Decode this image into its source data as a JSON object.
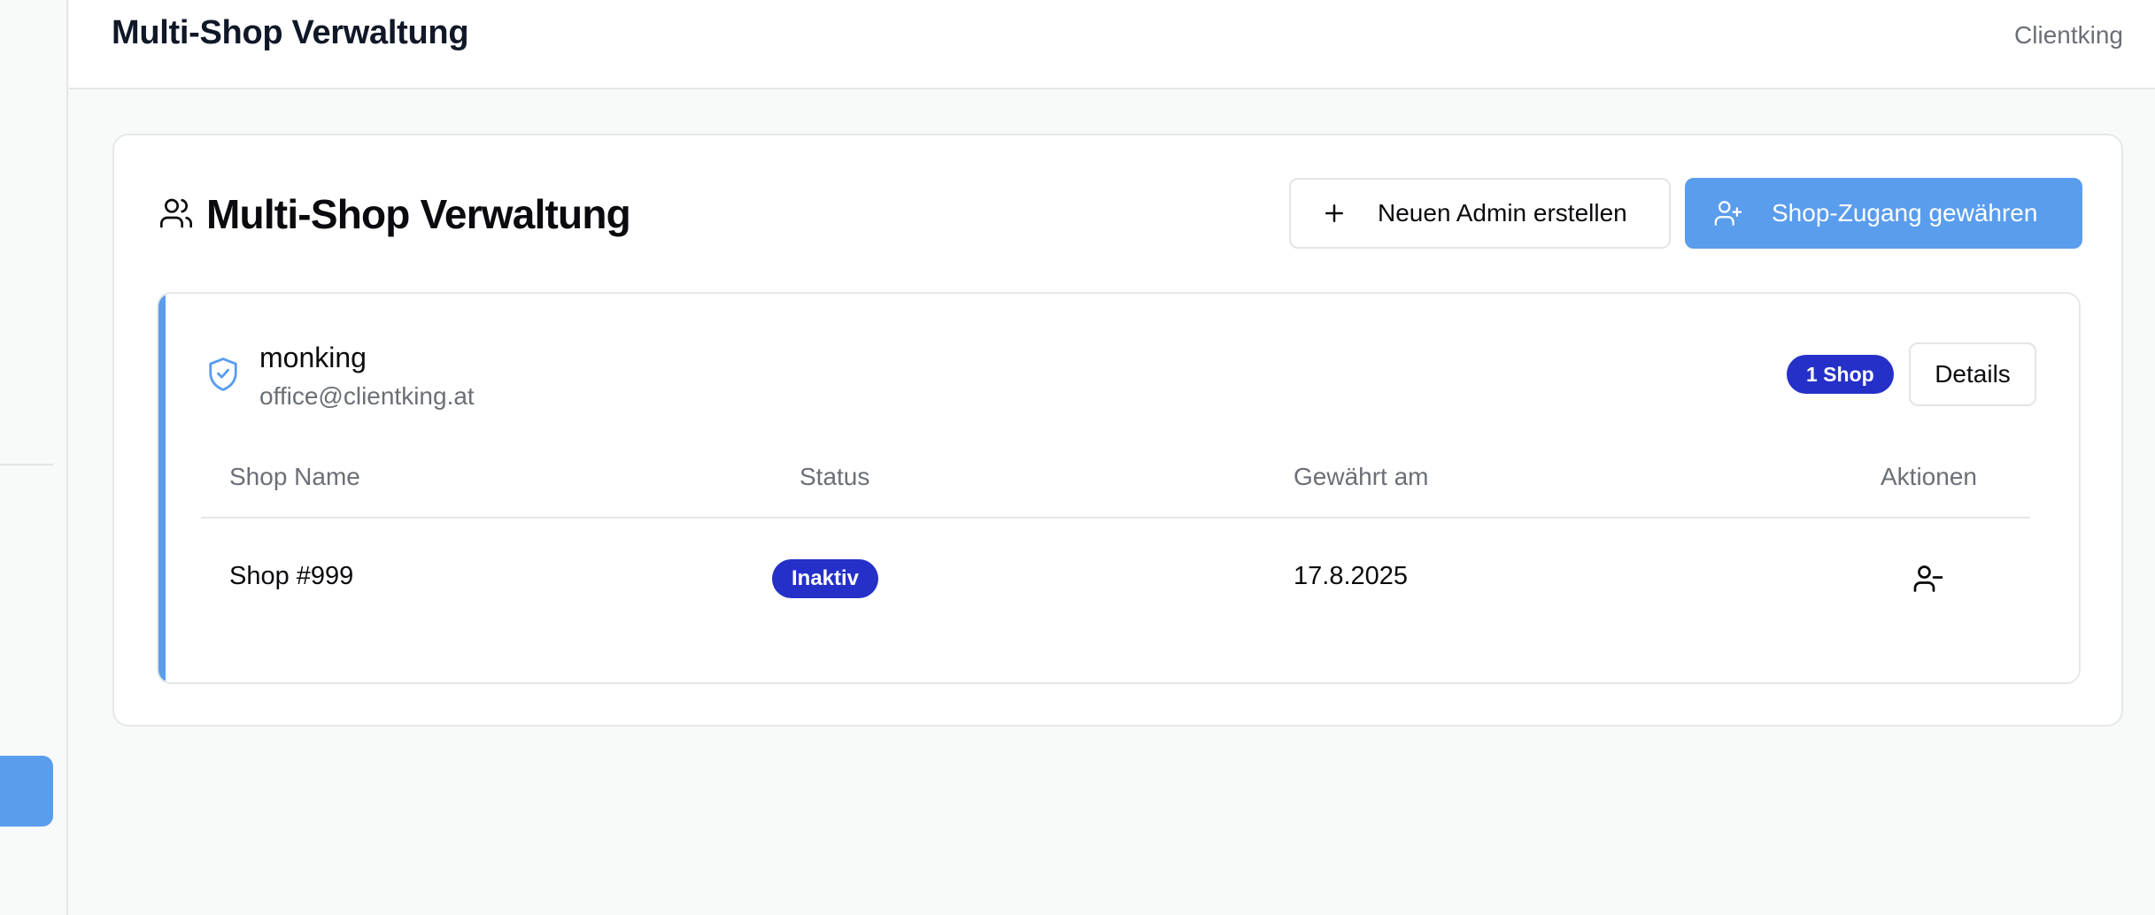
{
  "header": {
    "title": "Multi-Shop Verwaltung",
    "brand": "Clientking"
  },
  "card": {
    "heading": "Multi-Shop Verwaltung",
    "new_admin_label": "Neuen Admin erstellen",
    "grant_access_label": "Shop-Zugang gewähren"
  },
  "admin": {
    "name": "monking",
    "email": "office@clientking.at",
    "shop_count": "1 Shop",
    "details_label": "Details",
    "table": {
      "columns": [
        "Shop Name",
        "Status",
        "Gewährt am",
        "Aktionen"
      ],
      "rows": [
        {
          "shop_name": "Shop #999",
          "status": "Inaktiv",
          "granted": "17.8.2025"
        }
      ]
    }
  },
  "colors": {
    "accent": "#5a9ded",
    "badge": "#2530c9"
  },
  "icons": {
    "heading": "users-icon",
    "new_admin": "plus-icon",
    "grant_access": "user-plus-icon",
    "admin": "shield-check-icon",
    "remove": "user-minus-icon"
  }
}
